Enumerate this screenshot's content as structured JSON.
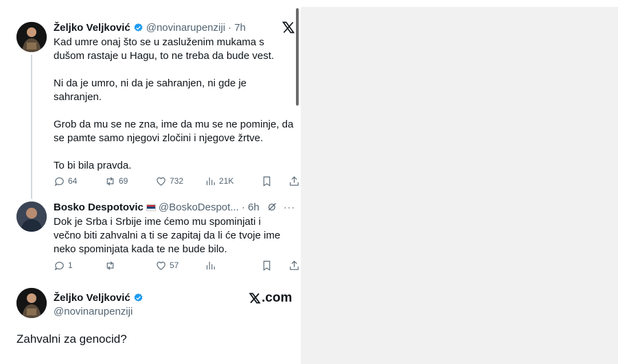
{
  "tweet1": {
    "name": "Željko Veljković",
    "handle": "@novinarupenziji",
    "time": "· 7h",
    "paragraphs": [
      "Kad umre onaj što se u zasluženim mukama s dušom rastaje u Hagu, to ne treba da bude vest.",
      "Ni da je umro, ni da je sahranjen, ni gde je sahranjen.",
      "Grob da mu se ne zna, ime da mu se ne pominje, da se pamte samo njegovi zločini i njegove žrtve.",
      "To bi bila pravda."
    ],
    "stats": {
      "replies": "64",
      "retweets": "69",
      "likes": "732",
      "views": "21K"
    }
  },
  "reply": {
    "name": "Bosko Despotovic",
    "handle": "@BoskoDespot...",
    "time": "· 6h",
    "text": "Dok je Srba i Srbije ime ćemo mu spominjati i večno biti zahvalni a ti se zapitaj da li će tvoje ime neko spominjata kada te ne bude bilo.",
    "stats": {
      "replies": "1",
      "retweets": "",
      "likes": "57"
    }
  },
  "quote": {
    "name": "Željko Veljković",
    "handle": "@novinarupenziji",
    "brand": ".com",
    "text": "Zahvalni za genocid?"
  },
  "colors": {
    "verified": "#1d9bf0",
    "text": "#0f1419",
    "muted": "#536471",
    "right_panel": "#f1f1f1"
  },
  "icons": [
    "x-logo-icon",
    "verified-icon",
    "reply-icon",
    "retweet-icon",
    "like-icon",
    "views-icon",
    "bookmark-icon",
    "share-icon",
    "grok-icon",
    "more-icon",
    "flag-icon"
  ]
}
